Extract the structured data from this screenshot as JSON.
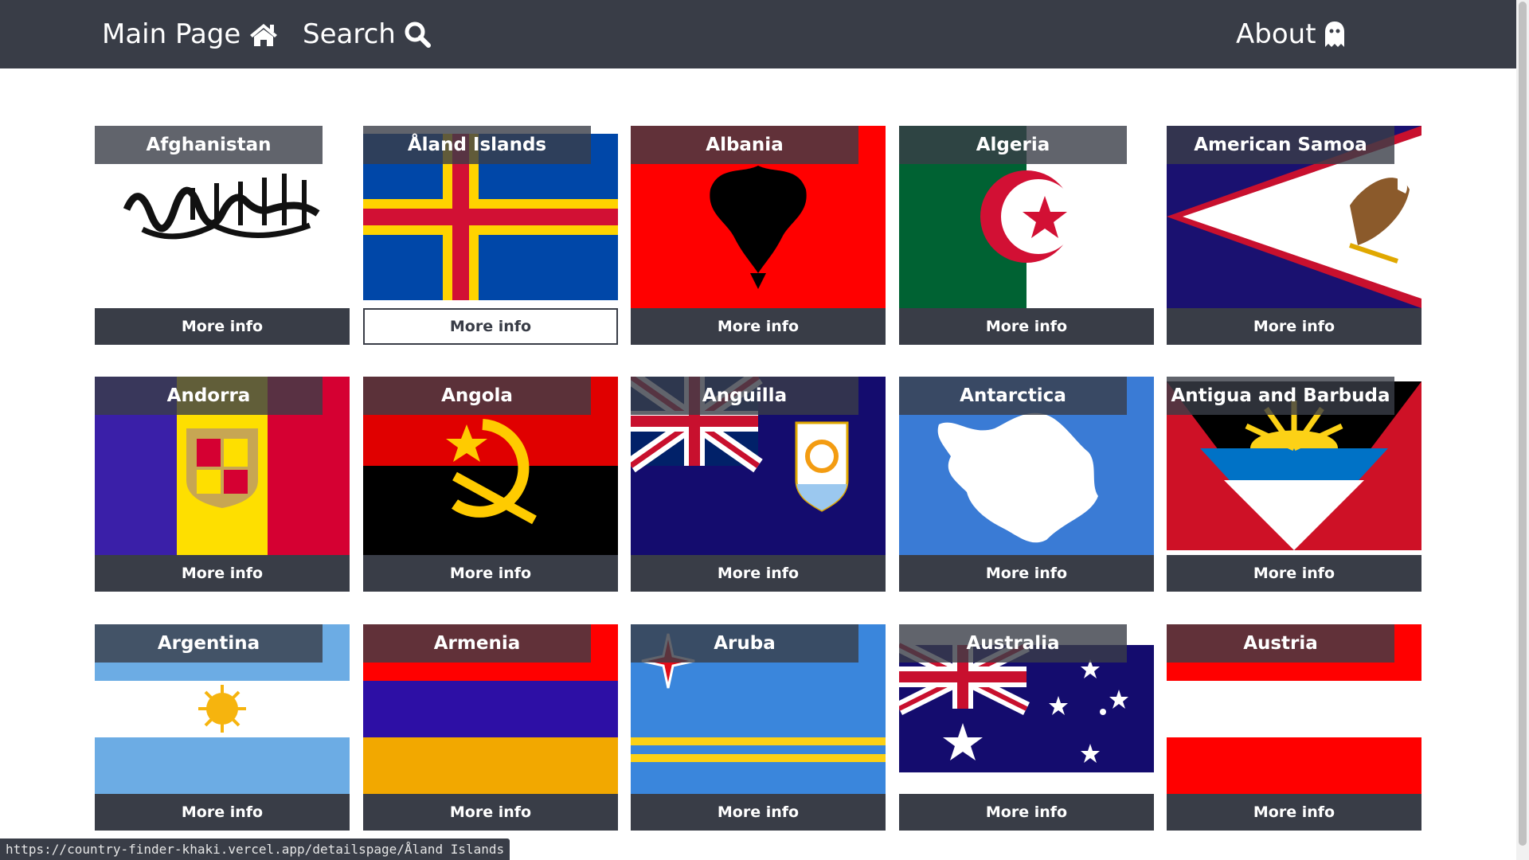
{
  "nav": {
    "main_label": "Main Page",
    "search_label": "Search",
    "about_label": "About",
    "icons": [
      "home-icon",
      "search-icon",
      "ghost-icon"
    ]
  },
  "colors": {
    "navbar": "#393d47",
    "button_text": "#ffffff"
  },
  "countries": [
    {
      "name": "Afghanistan",
      "button": "More info"
    },
    {
      "name": "Åland Islands",
      "button": "More info"
    },
    {
      "name": "Albania",
      "button": "More info"
    },
    {
      "name": "Algeria",
      "button": "More info"
    },
    {
      "name": "American Samoa",
      "button": "More info"
    },
    {
      "name": "Andorra",
      "button": "More info"
    },
    {
      "name": "Angola",
      "button": "More info"
    },
    {
      "name": "Anguilla",
      "button": "More info"
    },
    {
      "name": "Antarctica",
      "button": "More info"
    },
    {
      "name": "Antigua and Barbuda",
      "button": "More info"
    },
    {
      "name": "Argentina",
      "button": "More info"
    },
    {
      "name": "Armenia",
      "button": "More info"
    },
    {
      "name": "Aruba",
      "button": "More info"
    },
    {
      "name": "Australia",
      "button": "More info"
    },
    {
      "name": "Austria",
      "button": "More info"
    }
  ],
  "status_bar": {
    "url": "https://country-finder-khaki.vercel.app/detailspage/Åland Islands"
  }
}
